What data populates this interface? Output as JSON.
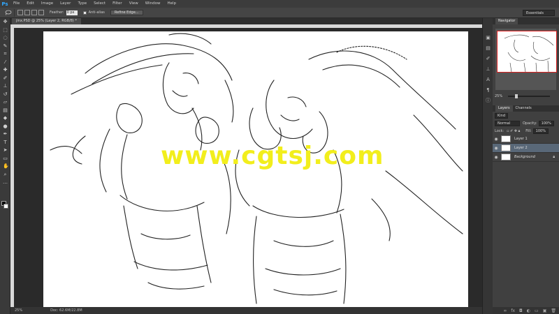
{
  "app": {
    "logo": "Ps"
  },
  "menu": [
    "File",
    "Edit",
    "Image",
    "Layer",
    "Type",
    "Select",
    "Filter",
    "View",
    "Window",
    "Help"
  ],
  "options": {
    "feather_label": "Feather:",
    "feather_value": "0 px",
    "antialias_label": "Anti-alias",
    "refine_edge_label": "Refine Edge...",
    "workspace": "Essentials"
  },
  "document": {
    "tab_label": "jinx.PSD @ 25% (Layer 2, RGB/8) *"
  },
  "watermark": "www.cgtsj.com",
  "status": {
    "zoom": "25%",
    "doc_size": "Doc: 62.6M/22.8M"
  },
  "navigator": {
    "title": "Navigator",
    "zoom": "25%"
  },
  "layers": {
    "tabs": [
      "Layers",
      "Channels"
    ],
    "kind_label": "Kind",
    "blend_mode": "Normal",
    "opacity_label": "Opacity:",
    "opacity_value": "100%",
    "lock_label": "Lock:",
    "fill_label": "Fill:",
    "fill_value": "100%",
    "items": [
      {
        "name": "Layer 1",
        "selected": false
      },
      {
        "name": "Layer 2",
        "selected": true
      },
      {
        "name": "Background",
        "selected": false
      }
    ]
  },
  "colors": {
    "accent": "#31a8ff",
    "watermark": "#f2ee1c",
    "selected_layer": "#596878"
  }
}
